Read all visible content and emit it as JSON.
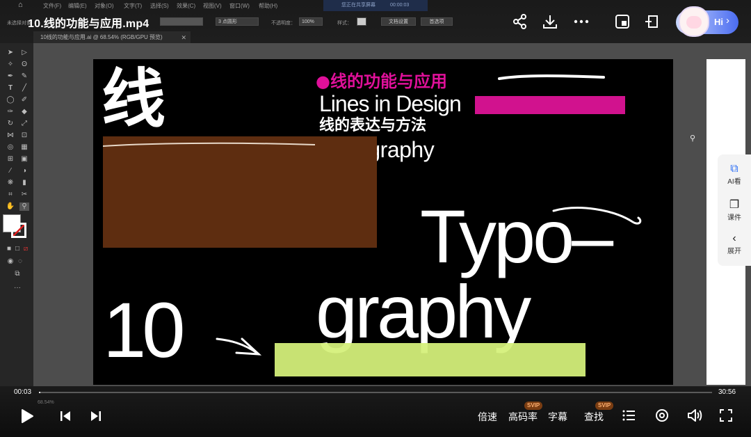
{
  "video": {
    "title": "10.线的功能与应用.mp4",
    "current_time": "00:03",
    "total_time": "30:56",
    "progress_fraction": 0.0016
  },
  "ai_app": {
    "menu": [
      "文件(F)",
      "编辑(E)",
      "对象(O)",
      "文字(T)",
      "选择(S)",
      "效果(C)",
      "视图(V)",
      "窗口(W)",
      "帮助(H)"
    ],
    "share_banner": "您正在共享屏幕",
    "share_time": "00:00:03",
    "options": {
      "selection_label": "未选择对象",
      "stroke_profile": "3 点圆形",
      "opacity_label": "不透明度：",
      "opacity_value": "100%",
      "style_label": "样式：",
      "doc_setup": "文档设置",
      "preferences": "首选项"
    },
    "document_tab": "10线的功能与应用.ai @ 68.54% (RGB/GPU 预览)",
    "zoom": "68.54%"
  },
  "artboard": {
    "big_char": "线",
    "pink_title": "●线的功能与应用",
    "subtitle_en": "Lines in Design",
    "subtitle_cn": "线的表达与方法",
    "typo_small": "Typography",
    "big_typo": "Typo–",
    "big_graphy": "graphy",
    "big_number": "10"
  },
  "side_panel": {
    "ai_label": "AI看",
    "course_label": "课件",
    "expand_label": "展开"
  },
  "header_actions": {
    "assistant_label": "Hi"
  },
  "controls": {
    "speed": "倍速",
    "bitrate": "高码率",
    "subtitles": "字幕",
    "search": "查找",
    "svip_badge": "SVIP"
  },
  "colors": {
    "magenta": "#d1128e",
    "pink_text": "#e0109a",
    "brown": "#5e2d10",
    "lime": "#d4f07a"
  }
}
